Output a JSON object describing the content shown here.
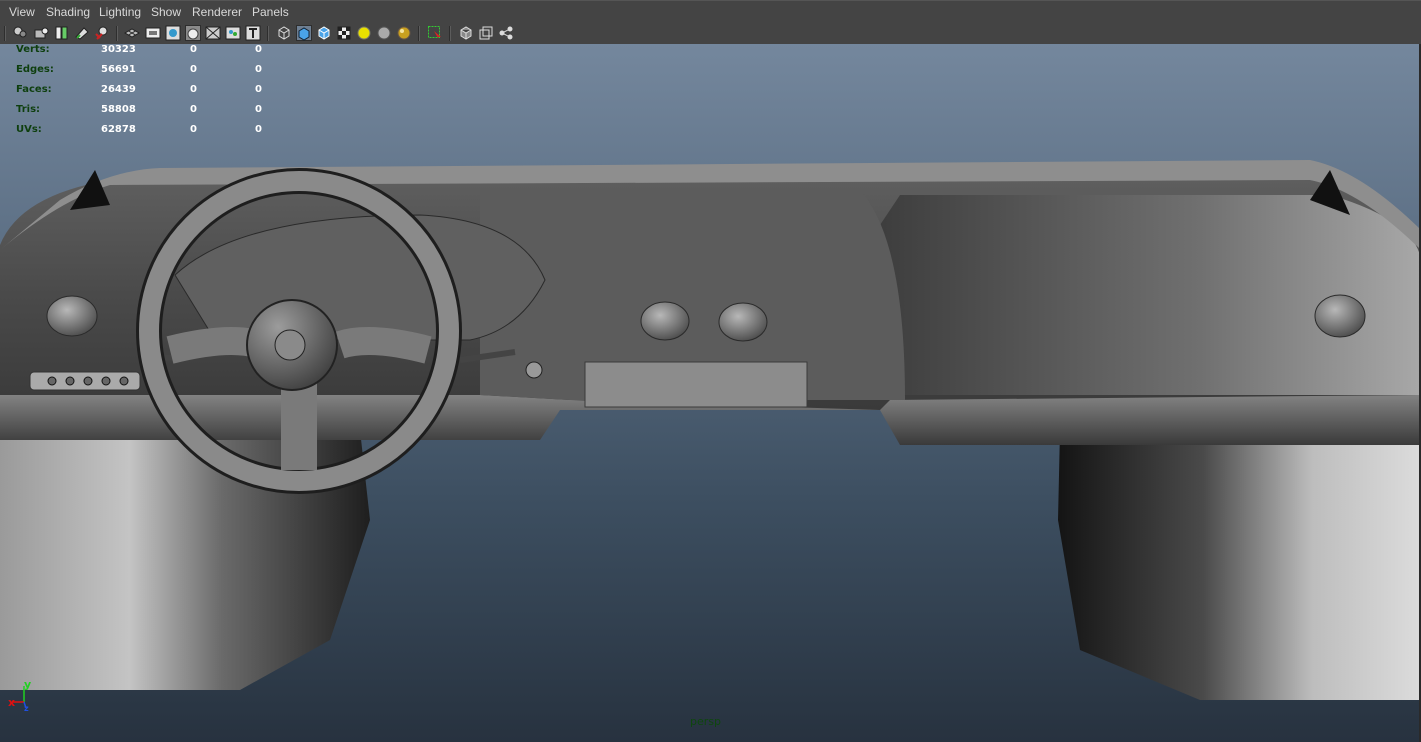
{
  "menu": {
    "items": [
      "View",
      "Shading",
      "Lighting",
      "Show",
      "Renderer",
      "Panels"
    ]
  },
  "toolbar": {
    "icons": [
      "select-camera-icon",
      "lock-camera-icon",
      "camera-attributes-icon",
      "bookmarks-icon",
      "image-plane-icon",
      "2d-pan-zoom-icon",
      "grid-icon",
      "film-gate-icon",
      "resolution-gate-icon",
      "gate-mask-icon",
      "field-chart-icon",
      "safe-action-icon",
      "safe-title-icon",
      "wireframe-icon",
      "smooth-shade-all-icon",
      "wireframe-on-shaded-icon",
      "textured-icon",
      "use-all-lights-icon",
      "shadows-icon",
      "ambient-occlusion-icon",
      "isolate-select-icon",
      "xray-icon",
      "xray-active-components-icon",
      "xray-joints-icon"
    ]
  },
  "hud": {
    "rows": [
      {
        "label": "Verts:",
        "c1": "30323",
        "c2": "0",
        "c3": "0"
      },
      {
        "label": "Edges:",
        "c1": "56691",
        "c2": "0",
        "c3": "0"
      },
      {
        "label": "Faces:",
        "c1": "26439",
        "c2": "0",
        "c3": "0"
      },
      {
        "label": "Tris:",
        "c1": "58808",
        "c2": "0",
        "c3": "0"
      },
      {
        "label": "UVs:",
        "c1": "62878",
        "c2": "0",
        "c3": "0"
      }
    ]
  },
  "viewport": {
    "camera": "persp"
  },
  "axis": {
    "x": "x",
    "y": "y",
    "z": "z"
  },
  "colors": {
    "ui_bg": "#444444",
    "viewport_top": "#74879d",
    "viewport_bottom": "#27323f",
    "hud_label": "#0e3f0e",
    "axis_x": "#e01010",
    "axis_y": "#20d020",
    "axis_z": "#2050e0"
  }
}
